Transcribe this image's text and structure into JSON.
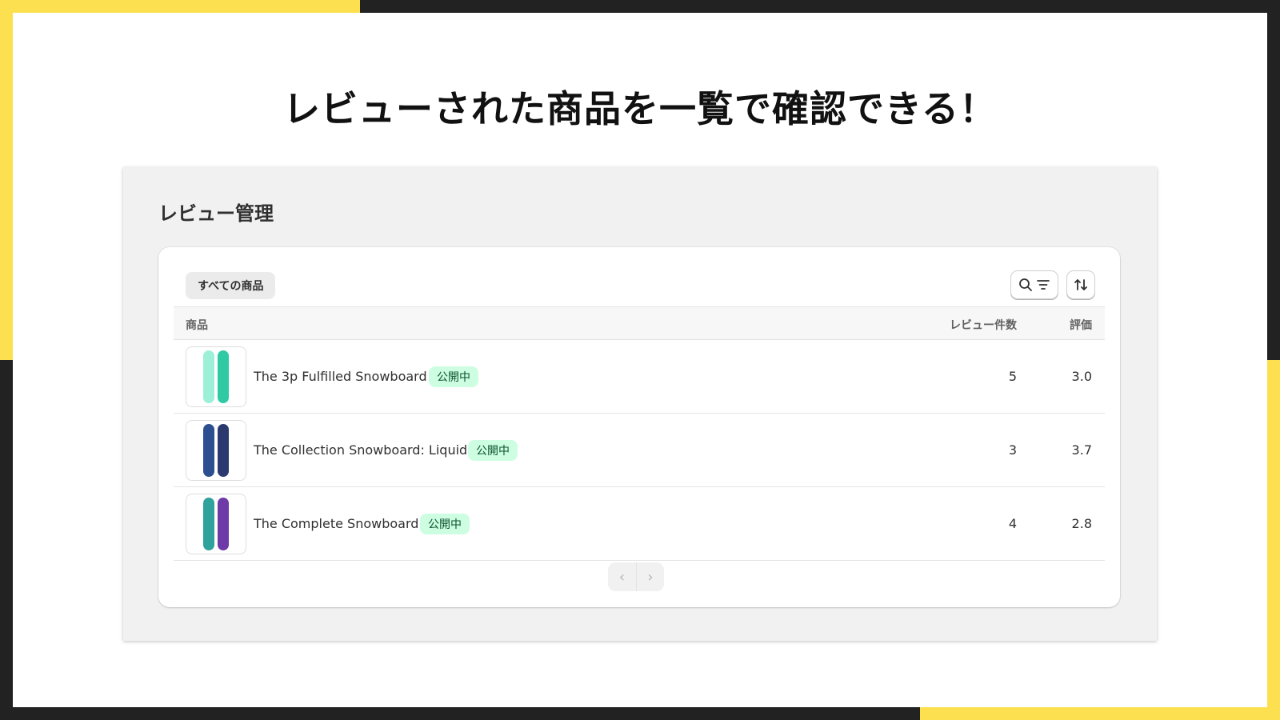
{
  "headline": "レビューされた商品を一覧で確認できる！",
  "colors": {
    "accent_yellow": "#fde050",
    "frame_dark": "#222222",
    "badge_bg": "#cdfee1",
    "badge_text": "#0c5132"
  },
  "panel": {
    "title": "レビュー管理",
    "filter_tab": "すべての商品",
    "toolbar": {
      "search_filter_icons": [
        "search-icon",
        "filter-icon"
      ],
      "sort_icon": "sort-icon"
    },
    "columns": {
      "product": "商品",
      "review_count": "レビュー件数",
      "rating": "評価"
    },
    "rows": [
      {
        "name": "The 3p Fulfilled Snowboard",
        "status": "公開中",
        "review_count": "5",
        "rating": "3.0",
        "board_colors": [
          "#9df0d8",
          "#2fc9a3"
        ]
      },
      {
        "name": "The Collection Snowboard: Liquid",
        "status": "公開中",
        "review_count": "3",
        "rating": "3.7",
        "board_colors": [
          "#2c4f8f",
          "#2b3a6e"
        ]
      },
      {
        "name": "The Complete Snowboard",
        "status": "公開中",
        "review_count": "4",
        "rating": "2.8",
        "board_colors": [
          "#2fa29b",
          "#6d3aa8"
        ]
      }
    ],
    "pagination": {
      "prev_icon": "chevron-left-icon",
      "next_icon": "chevron-right-icon"
    }
  }
}
